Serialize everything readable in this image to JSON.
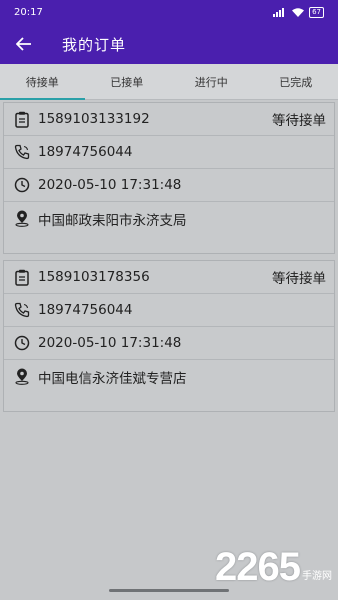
{
  "status_bar": {
    "time": "20:17",
    "battery": "67"
  },
  "header": {
    "title": "我的订单"
  },
  "tabs": [
    {
      "label": "待接单"
    },
    {
      "label": "已接单"
    },
    {
      "label": "进行中"
    },
    {
      "label": "已完成"
    }
  ],
  "orders": [
    {
      "order_no": "1589103133192",
      "status": "等待接单",
      "phone": "18974756044",
      "datetime": "2020-05-10 17:31:48",
      "address": "中国邮政耒阳市永济支局"
    },
    {
      "order_no": "1589103178356",
      "status": "等待接单",
      "phone": "18974756044",
      "datetime": "2020-05-10 17:31:48",
      "address": "中国电信永济佳斌专营店"
    }
  ],
  "watermark": {
    "number": "2265",
    "suffix": "手游网"
  },
  "colors": {
    "primary": "#4a1fae",
    "tab_indicator": "#2aa0a8"
  }
}
